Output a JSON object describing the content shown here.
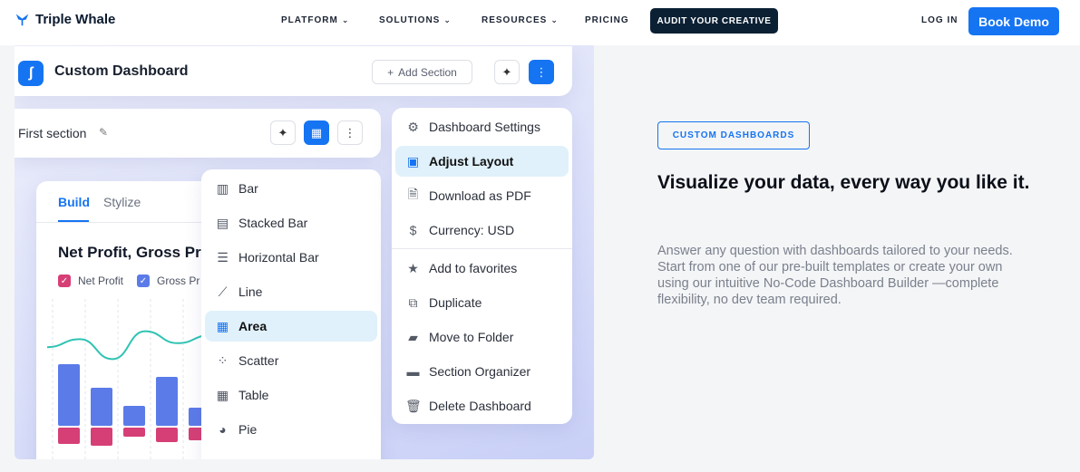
{
  "nav": {
    "brand": "Triple Whale",
    "items": [
      {
        "label": "PLATFORM",
        "has_chevron": true
      },
      {
        "label": "SOLUTIONS",
        "has_chevron": true
      },
      {
        "label": "RESOURCES",
        "has_chevron": true
      },
      {
        "label": "PRICING",
        "has_chevron": false
      }
    ],
    "cta_dark": "AUDIT YOUR CREATIVE",
    "login": "LOG IN",
    "cta_blue": "Book Demo"
  },
  "dashboard": {
    "title": "Custom Dashboard",
    "add_section": "Add Section",
    "section_title": "First section",
    "tabs": {
      "build": "Build",
      "stylize": "Stylize"
    },
    "chart_title": "Net Profit, Gross Pr",
    "legend": [
      {
        "label": "Net Profit",
        "color": "#d63f76"
      },
      {
        "label": "Gross Pr",
        "color": "#5b7be8"
      }
    ]
  },
  "chart_types": [
    {
      "label": "Bar",
      "icon": "bar-chart-icon",
      "glyph": "▥"
    },
    {
      "label": "Stacked Bar",
      "icon": "stacked-bar-icon",
      "glyph": "▤"
    },
    {
      "label": "Horizontal Bar",
      "icon": "horizontal-bar-icon",
      "glyph": "☰"
    },
    {
      "label": "Line",
      "icon": "line-chart-icon",
      "glyph": "⟋"
    },
    {
      "label": "Area",
      "icon": "area-chart-icon",
      "glyph": "▦",
      "active": true
    },
    {
      "label": "Scatter",
      "icon": "scatter-icon",
      "glyph": "⁘"
    },
    {
      "label": "Table",
      "icon": "table-icon",
      "glyph": "▦"
    },
    {
      "label": "Pie",
      "icon": "pie-chart-icon",
      "glyph": "◕"
    }
  ],
  "options": [
    {
      "label": "Dashboard Settings",
      "icon": "gear-icon",
      "glyph": "⚙"
    },
    {
      "label": "Adjust Layout",
      "icon": "layout-icon",
      "glyph": "▣",
      "active": true
    },
    {
      "label": "Download as PDF",
      "icon": "pdf-icon",
      "glyph": "🗎"
    },
    {
      "label": "Currency: USD",
      "icon": "currency-icon",
      "glyph": "$"
    },
    {
      "label": "Add to favorites",
      "icon": "star-icon",
      "glyph": "★"
    },
    {
      "label": "Duplicate",
      "icon": "duplicate-icon",
      "glyph": "⧉"
    },
    {
      "label": "Move to Folder",
      "icon": "folder-icon",
      "glyph": "▰"
    },
    {
      "label": "Section Organizer",
      "icon": "organizer-icon",
      "glyph": "▬"
    },
    {
      "label": "Delete Dashboard",
      "icon": "trash-icon",
      "glyph": "🗑"
    }
  ],
  "hero": {
    "tag": "CUSTOM DASHBOARDS",
    "headline": "Visualize your data, every way you like it.",
    "description": "Answer any question with dashboards tailored to your needs. Start from one of our pre-built templates or create your own using our intuitive No-Code Dashboard Builder —complete flexibility, no dev team required."
  },
  "colors": {
    "accent": "#1574f2",
    "dark": "#0b2033",
    "net_profit": "#d63f76",
    "gross_profit": "#5b7be8",
    "line": "#2fc3b3"
  },
  "chart_data": {
    "type": "bar",
    "stacked": true,
    "series": [
      {
        "name": "Net Profit",
        "values": [
          18,
          20,
          10,
          16,
          14
        ]
      },
      {
        "name": "Gross Pr",
        "values": [
          68,
          42,
          22,
          54,
          20
        ]
      }
    ],
    "line": [
      44,
      48,
      38,
      52,
      46,
      50
    ],
    "title": "Net Profit, Gross Pr",
    "xlabel": "",
    "ylabel": ""
  }
}
